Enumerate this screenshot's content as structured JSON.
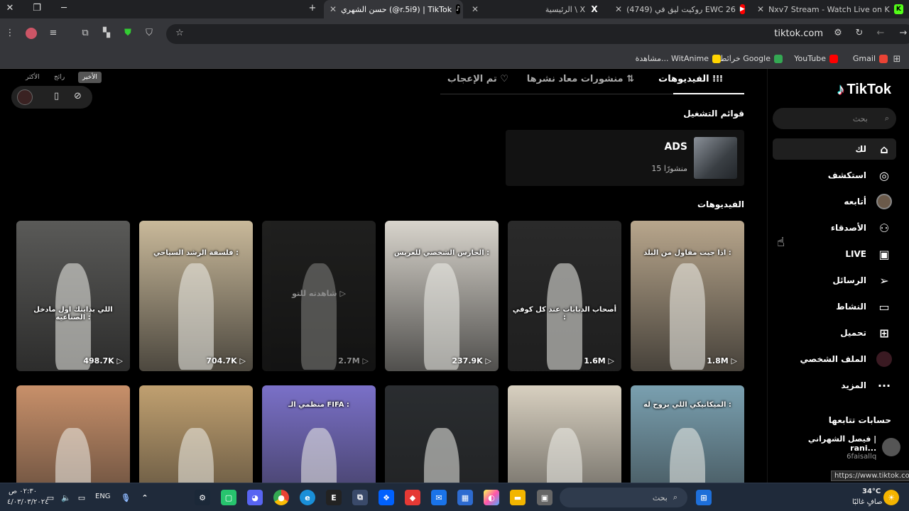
{
  "browser": {
    "tabs": [
      {
        "title": "Nxv7 Stream - Watch Live on K",
        "fav": "K",
        "favColor": "#53fc18"
      },
      {
        "title": "(4749) روكيت ليق في EWC 26",
        "fav": "▶",
        "favColor": "#ff0000"
      },
      {
        "title": "الرئيسية \\ X",
        "fav": "X",
        "favColor": "#000000"
      },
      {
        "title": "حسن الشهري (@r.5i9) | TikTok",
        "fav": "♪",
        "favColor": "#000000"
      }
    ],
    "new_tab": "+",
    "url": "tiktok.com",
    "bookmarks": [
      {
        "label": "Gmail",
        "color": "#ea4335"
      },
      {
        "label": "YouTube",
        "color": "#ff0000"
      },
      {
        "label": "خرائط Google",
        "color": "#34a853"
      },
      {
        "label": "مشاهدة... WitAnime",
        "color": "#ffd400"
      }
    ]
  },
  "sidebar": {
    "logo": "TikTok",
    "search_placeholder": "بحث",
    "nav": [
      {
        "label": "لك",
        "icon": "⌂",
        "name": "home-icon"
      },
      {
        "label": "استكشف",
        "icon": "◎",
        "name": "compass-icon"
      },
      {
        "label": "أتابعه",
        "icon": "",
        "name": "following-avatar"
      },
      {
        "label": "الأصدقاء",
        "icon": "⚇",
        "name": "friends-icon"
      },
      {
        "label": "LIVE",
        "icon": "▣",
        "name": "live-icon"
      },
      {
        "label": "الرسائل",
        "icon": "➢",
        "name": "messages-icon"
      },
      {
        "label": "النشاط",
        "icon": "▭",
        "name": "activity-icon"
      },
      {
        "label": "تحميل",
        "icon": "⊞",
        "name": "upload-icon"
      },
      {
        "label": "الملف الشخصي",
        "icon": "",
        "name": "profile-avatar"
      },
      {
        "label": "المزيد",
        "icon": "···",
        "name": "more-icon"
      }
    ],
    "following_title": "حسابات تتابعها",
    "following": [
      {
        "name": "فيصل الشهراني | rani...",
        "handle": "6faisallq"
      }
    ]
  },
  "profile": {
    "tabs": [
      "الفيديوهات",
      "منشورات معاد نشرها",
      "تم الإعجاب"
    ],
    "playlists_title": "قوائم التشغيل",
    "playlist": {
      "title": "ADS",
      "count": "15 منشورًا"
    },
    "videos_title": "الفيديوهات",
    "watched_label": "شاهدته للتو",
    "videos": [
      {
        "views": "1.8M",
        "caption": "اذا جيت مقاول من البلد :",
        "bg": "#b8a68c"
      },
      {
        "views": "1.6M",
        "caption": "أصحاب الدبابات عند كل كوفي :",
        "bg": "#2a2a2a"
      },
      {
        "views": "237.9K",
        "caption": "الحارس الشخصي للعريس :",
        "bg": "#d8d4cc"
      },
      {
        "views": "2.7M",
        "caption": "",
        "bg": "#3a3a38"
      },
      {
        "views": "704.7K",
        "caption": "فلسفة الرشد السياحي :",
        "bg": "#c9b99a"
      },
      {
        "views": "498.7K",
        "caption": "اللي بدايتك اول مادخل الصناعية :",
        "bg": "#5a5a58"
      },
      {
        "views": "",
        "caption": "الميكانيكي اللي بروح له :",
        "bg": "#7aa0b0"
      },
      {
        "views": "",
        "caption": "",
        "bg": "#d8d0c0"
      },
      {
        "views": "",
        "caption": "",
        "bg": "#2a2d30"
      },
      {
        "views": "",
        "caption": "منظمي الـ FIFA :",
        "bg": "#7a70c8"
      },
      {
        "views": "",
        "caption": "",
        "bg": "#c0a070"
      },
      {
        "views": "",
        "caption": "",
        "bg": "#c8906a"
      }
    ]
  },
  "miniplayer": {
    "tabs": [
      "الأخير",
      "رائج",
      "الأكثر"
    ]
  },
  "taskbar": {
    "search_placeholder": "بحث",
    "weather_temp": "34°C",
    "weather_desc": "صافٍ غالبًا",
    "lang": "ENG",
    "time": "٠٢:٣٠ ص",
    "date": "٤/٠٣/٠٣/٢٠٢٤",
    "tooltip": "https://www.tiktok.com"
  }
}
